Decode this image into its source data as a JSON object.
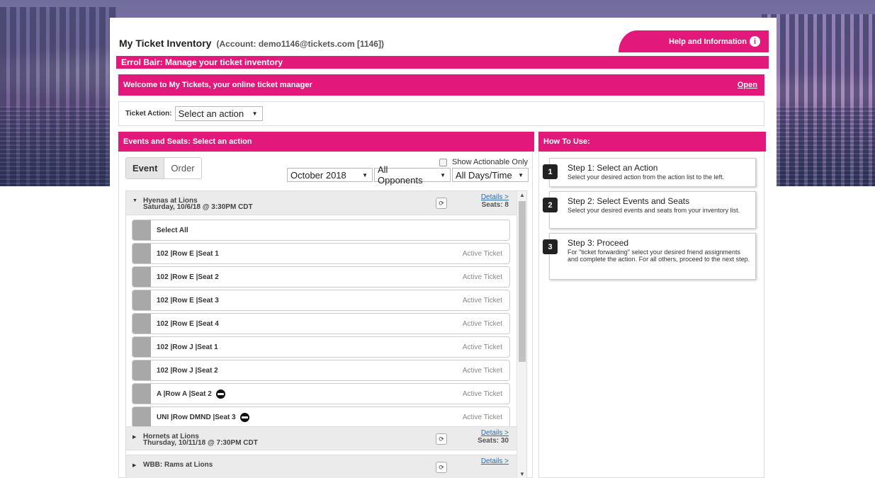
{
  "header": {
    "title": "My Ticket Inventory",
    "account": "(Account: demo1146@tickets.com [1146])",
    "help_label": "Help and Information",
    "manage_label": "Errol Bair: Manage your ticket inventory"
  },
  "welcome": {
    "text": "Welcome to My Tickets, your online ticket manager",
    "open_label": "Open"
  },
  "ticket_action": {
    "label": "Ticket Action:",
    "selected": "Select an action"
  },
  "events_panel": {
    "title": "Events and Seats: Select an action",
    "toggle": [
      "Event",
      "Order"
    ],
    "show_actionable_label": "Show Actionable Only",
    "filters": {
      "month": "October 2018",
      "opponents": "All Opponents",
      "days": "All Days/Time"
    },
    "events": [
      {
        "name": "Hyenas at Lions",
        "date": "Saturday, 10/6/18 @ 3:30PM CDT",
        "details": "Details >",
        "seats": "Seats: 8",
        "expanded": true
      },
      {
        "name": "Hornets at Lions",
        "date": "Thursday, 10/11/18 @ 7:30PM CDT",
        "details": "Details >",
        "seats": "Seats: 30",
        "expanded": false
      },
      {
        "name": "WBB: Rams at Lions",
        "date": "",
        "details": "Details >",
        "seats": "",
        "expanded": false
      }
    ],
    "select_all": "Select All",
    "seats": [
      {
        "label": "102 |Row E |Seat 1",
        "status": "Active Ticket",
        "icon": ""
      },
      {
        "label": "102 |Row E |Seat 2",
        "status": "Active Ticket",
        "icon": ""
      },
      {
        "label": "102 |Row E |Seat 3",
        "status": "Active Ticket",
        "icon": ""
      },
      {
        "label": "102 |Row E |Seat 4",
        "status": "Active Ticket",
        "icon": ""
      },
      {
        "label": "102 |Row J |Seat 1",
        "status": "Active Ticket",
        "icon": ""
      },
      {
        "label": "102 |Row J |Seat 2",
        "status": "Active Ticket",
        "icon": ""
      },
      {
        "label": "A |Row A |Seat 2",
        "status": "Active Ticket",
        "icon": "mask-icon"
      },
      {
        "label": "UNI |Row DMND |Seat 3",
        "status": "Active Ticket",
        "icon": "mask-icon"
      }
    ]
  },
  "howto": {
    "title": "How To Use:",
    "steps": [
      {
        "num": "1",
        "title": "Step 1: Select an Action",
        "desc": "Select your desired action from the action list to the left."
      },
      {
        "num": "2",
        "title": "Step 2: Select Events and Seats",
        "desc": "Select your desired events and seats from your inventory list."
      },
      {
        "num": "3",
        "title": "Step 3: Proceed",
        "desc": "For \"ticket forwarding\" select your desired friend assignments and complete the action. For all others, proceed to the next step."
      }
    ]
  },
  "colors": {
    "accent": "#e2197b",
    "link": "#2a6db5"
  }
}
